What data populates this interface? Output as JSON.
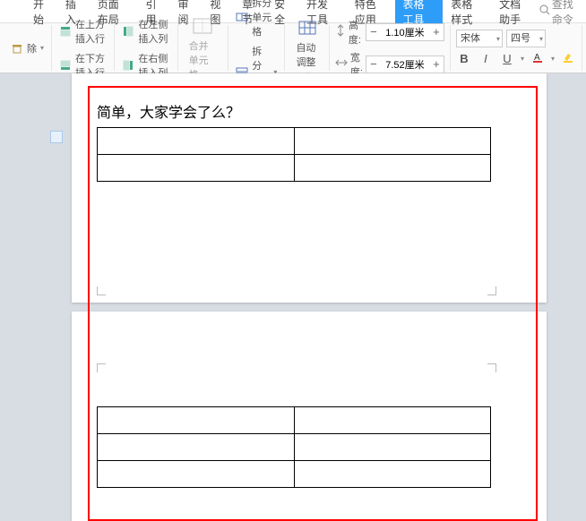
{
  "tabs": {
    "items": [
      "开始",
      "插入",
      "页面布局",
      "引用",
      "审阅",
      "视图",
      "章节",
      "安全",
      "开发工具",
      "特色应用",
      "表格工具",
      "表格样式",
      "文档助手"
    ],
    "active_index": 10,
    "search_placeholder": "查找命令"
  },
  "toolbar": {
    "delete": "除",
    "insert_above": "在上方插入行",
    "insert_below": "在下方插入行",
    "insert_left": "在左侧插入列",
    "insert_right": "在右侧插入列",
    "merge_cells": "合并单元格",
    "split_cells": "拆分单元格",
    "split_table": "拆分表格",
    "auto_adjust": "自动调整",
    "height_label": "高度:",
    "width_label": "宽度:",
    "height_value": "1.10厘米",
    "width_value": "7.52厘米",
    "font_name": "宋体",
    "font_size": "四号",
    "minus": "−",
    "plus": "+"
  },
  "document": {
    "text_line": "简单，大家学会了么？"
  },
  "chart_data": {
    "type": "table",
    "tables": [
      {
        "page": 1,
        "rows": 2,
        "cols": 2,
        "values": [
          [
            "",
            ""
          ],
          [
            "",
            ""
          ]
        ]
      },
      {
        "page": 2,
        "rows": 3,
        "cols": 2,
        "values": [
          [
            "",
            ""
          ],
          [
            "",
            ""
          ],
          [
            "",
            ""
          ]
        ]
      }
    ]
  }
}
